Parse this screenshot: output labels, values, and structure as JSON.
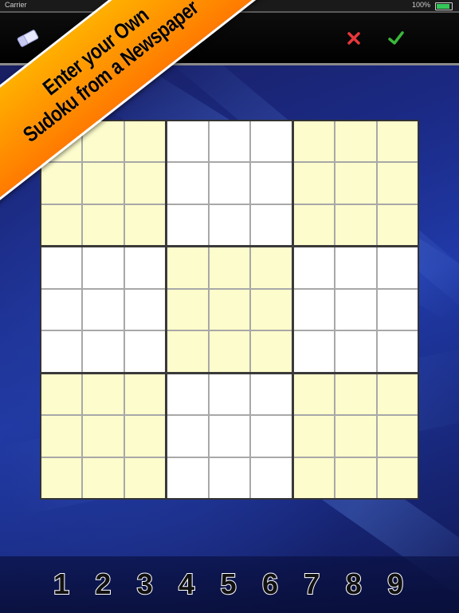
{
  "status_bar": {
    "carrier": "Carrier",
    "time": "",
    "battery": "100%",
    "battery_level": 1.0
  },
  "toolbar": {
    "eraser_icon": "eraser-icon",
    "cancel_icon": "x-icon",
    "confirm_icon": "checkmark-icon",
    "cancel_color": "#e8373b",
    "confirm_color": "#3ab83a"
  },
  "banner": {
    "line1": "Enter your Own",
    "line2": "Sudoku from a Newspaper",
    "color": "#ff9800"
  },
  "grid": {
    "shaded_color": "#fdfccc",
    "shaded_boxes": [
      0,
      2,
      4,
      6,
      8
    ],
    "cells": [
      [
        "",
        "",
        "",
        "",
        "",
        "",
        "",
        "",
        ""
      ],
      [
        "",
        "",
        "",
        "",
        "",
        "",
        "",
        "",
        ""
      ],
      [
        "",
        "",
        "",
        "",
        "",
        "",
        "",
        "",
        ""
      ],
      [
        "",
        "",
        "",
        "",
        "",
        "",
        "",
        "",
        ""
      ],
      [
        "",
        "",
        "",
        "",
        "",
        "",
        "",
        "",
        ""
      ],
      [
        "",
        "",
        "",
        "",
        "",
        "",
        "",
        "",
        ""
      ],
      [
        "",
        "",
        "",
        "",
        "",
        "",
        "",
        "",
        ""
      ],
      [
        "",
        "",
        "",
        "",
        "",
        "",
        "",
        "",
        ""
      ],
      [
        "",
        "",
        "",
        "",
        "",
        "",
        "",
        "",
        ""
      ]
    ]
  },
  "number_pad": {
    "keys": [
      "1",
      "2",
      "3",
      "4",
      "5",
      "6",
      "7",
      "8",
      "9"
    ]
  }
}
